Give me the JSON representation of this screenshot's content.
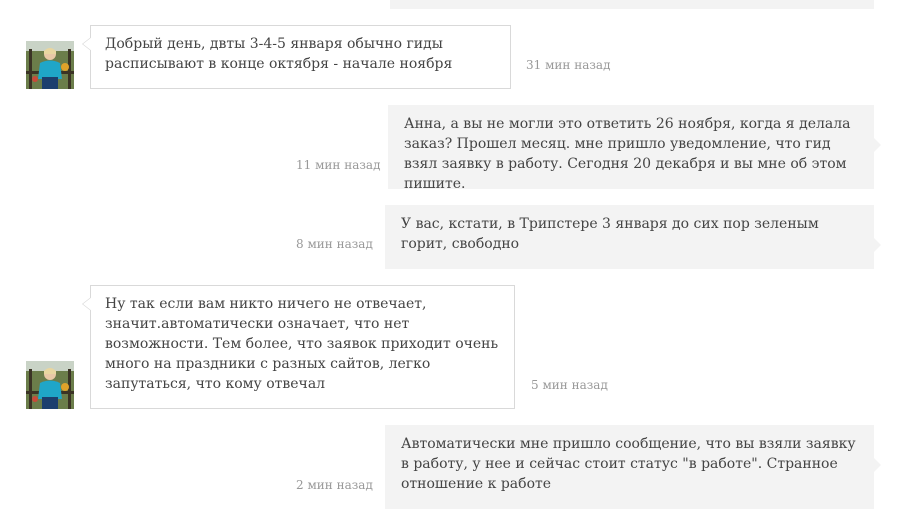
{
  "messages": [
    {
      "id": "m1",
      "direction": "incoming",
      "text": "Добрый день, двты 3-4-5 января обычно гиды расписывают в конце октября - начале ноября",
      "time": "31 мин назад"
    },
    {
      "id": "m2",
      "direction": "outgoing",
      "text": "Анна, а вы не могли это ответить 26 ноября, когда я делала заказ? Прошел месяц. мне пришло уведомление, что гид взял заявку в работу. Сегодня 20 декабря и вы мне об этом пишите.",
      "time": "11 мин назад"
    },
    {
      "id": "m3",
      "direction": "outgoing",
      "text": "У вас, кстати, в Трипстере 3 января до сих пор зеленым горит, свободно",
      "time": "8 мин назад"
    },
    {
      "id": "m4",
      "direction": "incoming",
      "text": "Ну так если вам никто ничего не отвечает, значит.автоматически означает, что нет возможности. Тем более, что заявок приходит очень много на праздники с разных сайтов, легко запутаться, что кому отвечал",
      "time": "5 мин назад"
    },
    {
      "id": "m5",
      "direction": "outgoing",
      "text": "Автоматически мне пришло сообщение, что вы взяли заявку в работу, у нее и сейчас стоит статус \"в работе\". Странное отношение к работе",
      "time": "2 мин назад"
    }
  ],
  "colors": {
    "incoming_bg": "#ffffff",
    "incoming_border": "#d9d9d9",
    "outgoing_bg": "#f3f3f3",
    "text": "#444444",
    "timestamp": "#999999"
  },
  "icons": {
    "avatar": "user-avatar-photo"
  }
}
